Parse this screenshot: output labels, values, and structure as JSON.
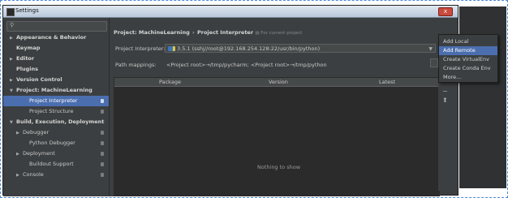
{
  "window": {
    "title": "Settings",
    "close_label": "x"
  },
  "sidebar": {
    "search_placeholder": "",
    "items": [
      {
        "label": "Appearance & Behavior",
        "arrow": "▶"
      },
      {
        "label": "Keymap",
        "arrow": ""
      },
      {
        "label": "Editor",
        "arrow": "▶"
      },
      {
        "label": "Plugins",
        "arrow": ""
      },
      {
        "label": "Version Control",
        "arrow": "▶"
      },
      {
        "label": "Project: MachineLearning",
        "arrow": "▼"
      },
      {
        "label": "Project Interpreter",
        "arrow": ""
      },
      {
        "label": "Project Structure",
        "arrow": ""
      },
      {
        "label": "Build, Execution, Deployment",
        "arrow": "▼"
      },
      {
        "label": "Debugger",
        "arrow": "▶"
      },
      {
        "label": "Python Debugger",
        "arrow": ""
      },
      {
        "label": "Deployment",
        "arrow": "▶"
      },
      {
        "label": "Buildout Support",
        "arrow": ""
      },
      {
        "label": "Console",
        "arrow": "▶"
      }
    ]
  },
  "main": {
    "breadcrumb": {
      "project": "Project: MachineLearning",
      "separator": "›",
      "page": "Project Interpreter",
      "scope": "For current project"
    },
    "interpreter_label": "Project Interpreter:",
    "interpreter_value": "3.5.1 (sshj//root@192.168.254.128:22/usr/bin/python)",
    "path_mappings_label": "Path mappings:",
    "path_mappings_value": "<Project root>→/tmp/pycharm; <Project root>→/tmp/python",
    "table": {
      "columns": [
        "Package",
        "Version",
        "Latest"
      ],
      "empty_text": "Nothing to show"
    }
  },
  "gear_menu": {
    "items": [
      "Add Local",
      "Add Remote",
      "Create VirtualEnv",
      "Create Conda Env",
      "More..."
    ],
    "active_index": 1
  },
  "side_tools": {
    "add": "+",
    "remove": "−",
    "upgrade": "⬆"
  },
  "colors": {
    "background": "#3c3f41",
    "selection": "#4b6eaf",
    "table_bg": "#2b2b2b"
  }
}
